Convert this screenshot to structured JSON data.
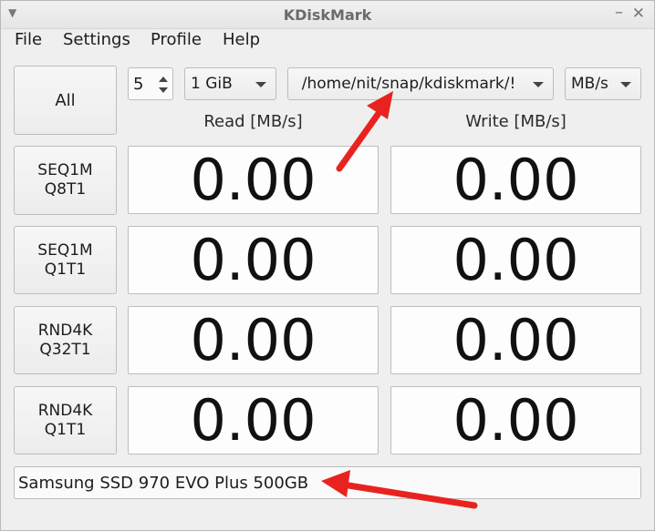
{
  "window": {
    "title": "KDiskMark"
  },
  "menu": [
    "File",
    "Settings",
    "Profile",
    "Help"
  ],
  "controls": {
    "all_label": "All",
    "count": "5",
    "size": "1 GiB",
    "path": "/home/nit/snap/kdiskmark/!",
    "units": "MB/s"
  },
  "headers": {
    "read": "Read [MB/s]",
    "write": "Write [MB/s]"
  },
  "tests": [
    {
      "line1": "SEQ1M",
      "line2": "Q8T1",
      "read": "0.00",
      "write": "0.00"
    },
    {
      "line1": "SEQ1M",
      "line2": "Q1T1",
      "read": "0.00",
      "write": "0.00"
    },
    {
      "line1": "RND4K",
      "line2": "Q32T1",
      "read": "0.00",
      "write": "0.00"
    },
    {
      "line1": "RND4K",
      "line2": "Q1T1",
      "read": "0.00",
      "write": "0.00"
    }
  ],
  "device": "Samsung SSD 970 EVO Plus 500GB",
  "annotation_color": "#e8231f"
}
